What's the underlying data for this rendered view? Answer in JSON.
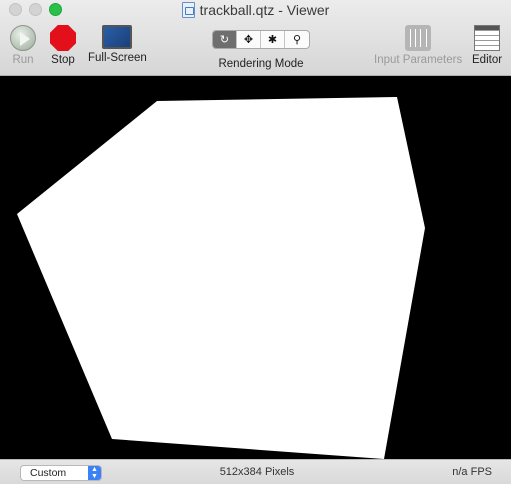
{
  "window": {
    "title": "trackball.qtz - Viewer"
  },
  "toolbar": {
    "run_label": "Run",
    "stop_label": "Stop",
    "fullscreen_label": "Full-Screen",
    "rendering_mode_label": "Rendering Mode",
    "rendering_modes": [
      {
        "icon": "rotate-icon",
        "glyph": "↻",
        "active": true
      },
      {
        "icon": "move-icon",
        "glyph": "✥",
        "active": false
      },
      {
        "icon": "bug-icon",
        "glyph": "✱",
        "active": false
      },
      {
        "icon": "magnifier-icon",
        "glyph": "⚲",
        "active": false
      }
    ],
    "input_parameters_label": "Input Parameters",
    "editor_label": "Editor"
  },
  "status_bar": {
    "size_option": "Custom",
    "dimensions_text": "512x384 Pixels",
    "fps_text": "n/a FPS"
  },
  "colors": {
    "stop_red": "#e3101c",
    "zoom_green": "#2ac14a",
    "canvas_bg": "#000000",
    "shape_fill": "#ffffff"
  }
}
